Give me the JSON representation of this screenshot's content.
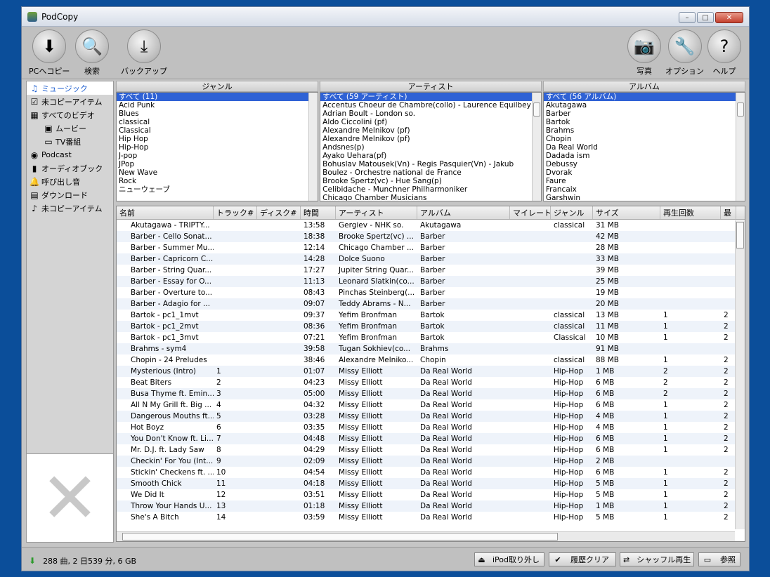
{
  "window": {
    "title": "PodCopy",
    "minimize": "–",
    "maximize": "□",
    "close": "✕"
  },
  "toolbar": {
    "left": [
      {
        "label": "PCへコピー",
        "icon": "down-arrow-icon",
        "glyph": "⬇"
      },
      {
        "label": "検索",
        "icon": "magnifier-icon",
        "glyph": "🔍"
      },
      {
        "label": "バックアップ",
        "icon": "backup-icon",
        "glyph": "⤓"
      }
    ],
    "right": [
      {
        "label": "写真",
        "icon": "camera-icon",
        "glyph": "📷"
      },
      {
        "label": "オプション",
        "icon": "wrench-icon",
        "glyph": "🔧"
      },
      {
        "label": "ヘルプ",
        "icon": "help-icon",
        "glyph": "?"
      }
    ]
  },
  "sidebar": {
    "items": [
      {
        "label": "ミュージック",
        "icon": "music-icon",
        "glyph": "♫",
        "sub": false,
        "selected": true
      },
      {
        "label": "未コピーアイテム",
        "icon": "checkbox-icon",
        "glyph": "☑",
        "sub": false,
        "selected": false
      },
      {
        "label": "すべてのビデオ",
        "icon": "film-icon",
        "glyph": "▦",
        "sub": false,
        "selected": false
      },
      {
        "label": "ムービー",
        "icon": "movie-icon",
        "glyph": "▣",
        "sub": true,
        "selected": false
      },
      {
        "label": "TV番組",
        "icon": "tv-icon",
        "glyph": "▭",
        "sub": true,
        "selected": false
      },
      {
        "label": "Podcast",
        "icon": "podcast-icon",
        "glyph": "◉",
        "sub": false,
        "selected": false
      },
      {
        "label": "オーディオブック",
        "icon": "audiobook-icon",
        "glyph": "▮",
        "sub": false,
        "selected": false
      },
      {
        "label": "呼び出し音",
        "icon": "bell-icon",
        "glyph": "🔔",
        "sub": false,
        "selected": false
      },
      {
        "label": "ダウンロード",
        "icon": "download-icon",
        "glyph": "▤",
        "sub": false,
        "selected": false
      },
      {
        "label": "未コピーアイテム",
        "icon": "note-icon",
        "glyph": "♪",
        "sub": false,
        "selected": false
      }
    ],
    "artwork_glyph": "✕"
  },
  "browser": {
    "genre": {
      "header": "ジャンル",
      "items": [
        "すべて (11)",
        "Acid Punk",
        "Blues",
        "classical",
        "Classical",
        "Hip Hop",
        "Hip-Hop",
        "J-pop",
        "JPop",
        "New Wave",
        "Rock",
        "ニューウェーブ"
      ]
    },
    "artist": {
      "header": "アーティスト",
      "items": [
        "すべて (59 アーティスト)",
        "Accentus Choeur de Chambre(collo) - Laurence Equilbey",
        "Adrian Boult - London so.",
        "Aldo Ciccolini (pf)",
        "Alexandre Melnikov (pf)",
        "Alexandre Melnikov (pf)",
        "Andsnes(p)",
        "Ayako Uehara(pf)",
        "Bohuslav Matousek(Vn) - Regis Pasquier(Vn) - Jakub",
        "Boulez - Orchestre national de France",
        "Brooke Spertz(vc) - Hue Sang(p)",
        "Celibidache - Munchner Philharmoniker",
        "Chicago Chamber Musicians"
      ]
    },
    "album": {
      "header": "アルバム",
      "items": [
        "すべて (56 アルバム)",
        "Akutagawa",
        "Barber",
        "Bartok",
        "Brahms",
        "Chopin",
        "Da Real World",
        "Dadada ism",
        "Debussy",
        "Dvorak",
        "Faure",
        "Francaix",
        "Garshwin"
      ]
    }
  },
  "table": {
    "columns": [
      "名前",
      "トラック#",
      "ディスク#",
      "時間",
      "アーティスト",
      "アルバム",
      "マイレート",
      "ジャンル",
      "サイズ",
      "再生回数",
      "最"
    ],
    "rows": [
      [
        "Akutagawa - TRIPTY...",
        "",
        "",
        "13:58",
        "Gergiev - NHK so.",
        "Akutagawa",
        "",
        "classical",
        "31 MB",
        "",
        ""
      ],
      [
        "Barber - Cello Sonat...",
        "",
        "",
        "18:38",
        "Brooke Spertz(vc) ...",
        "Barber",
        "",
        "",
        "42 MB",
        "",
        ""
      ],
      [
        "Barber - Summer Mu...",
        "",
        "",
        "12:14",
        "Chicago Chamber ...",
        "Barber",
        "",
        "",
        "28 MB",
        "",
        ""
      ],
      [
        "Barber - Capricorn C...",
        "",
        "",
        "14:28",
        "Dolce Suono",
        "Barber",
        "",
        "",
        "33 MB",
        "",
        ""
      ],
      [
        "Barber - String Quar...",
        "",
        "",
        "17:27",
        "Jupiter String Quar...",
        "Barber",
        "",
        "",
        "39 MB",
        "",
        ""
      ],
      [
        "Barber - Essay for O...",
        "",
        "",
        "11:13",
        "Leonard Slatkin(co...",
        "Barber",
        "",
        "",
        "25 MB",
        "",
        ""
      ],
      [
        "Barber - Overture to...",
        "",
        "",
        "08:43",
        "Pinchas Steinberg(...",
        "Barber",
        "",
        "",
        "19 MB",
        "",
        ""
      ],
      [
        "Barber - Adagio for ...",
        "",
        "",
        "09:07",
        "Teddy Abrams - N...",
        "Barber",
        "",
        "",
        "20 MB",
        "",
        ""
      ],
      [
        "Bartok - pc1_1mvt",
        "",
        "",
        "09:37",
        "Yefim Bronfman",
        "Bartok",
        "",
        "classical",
        "13 MB",
        "1",
        "2"
      ],
      [
        "Bartok - pc1_2mvt",
        "",
        "",
        "08:36",
        "Yefim Bronfman",
        "Bartok",
        "",
        "classical",
        "11 MB",
        "1",
        "2"
      ],
      [
        "Bartok - pc1_3mvt",
        "",
        "",
        "07:21",
        "Yefim Bronfman",
        "Bartok",
        "",
        "Classical",
        "10 MB",
        "1",
        "2"
      ],
      [
        "Brahms - sym4",
        "",
        "",
        "39:58",
        "Tugan Sokhiev(co...",
        "Brahms",
        "",
        "",
        "91 MB",
        "",
        ""
      ],
      [
        "Chopin - 24 Preludes",
        "",
        "",
        "38:46",
        "Alexandre Melniko...",
        "Chopin",
        "",
        "classical",
        "88 MB",
        "1",
        "2"
      ],
      [
        "Mysterious (Intro)",
        "1",
        "",
        "01:07",
        "Missy Elliott",
        "Da Real World",
        "",
        "Hip-Hop",
        "1 MB",
        "2",
        "2"
      ],
      [
        "Beat Biters",
        "2",
        "",
        "04:23",
        "Missy Elliott",
        "Da Real World",
        "",
        "Hip-Hop",
        "6 MB",
        "2",
        "2"
      ],
      [
        "Busa Thyme ft. Emin...",
        "3",
        "",
        "05:00",
        "Missy Elliott",
        "Da Real World",
        "",
        "Hip-Hop",
        "6 MB",
        "2",
        "2"
      ],
      [
        "All N My Grill ft. Big ...",
        "4",
        "",
        "04:32",
        "Missy Elliott",
        "Da Real World",
        "",
        "Hip-Hop",
        "6 MB",
        "1",
        "2"
      ],
      [
        "Dangerous Mouths ft....",
        "5",
        "",
        "03:28",
        "Missy Elliott",
        "Da Real World",
        "",
        "Hip-Hop",
        "4 MB",
        "1",
        "2"
      ],
      [
        "Hot Boyz",
        "6",
        "",
        "03:35",
        "Missy Elliott",
        "Da Real World",
        "",
        "Hip-Hop",
        "4 MB",
        "1",
        "2"
      ],
      [
        "You Don't Know ft. Li...",
        "7",
        "",
        "04:48",
        "Missy Elliott",
        "Da Real World",
        "",
        "Hip-Hop",
        "6 MB",
        "1",
        "2"
      ],
      [
        "Mr. D.J. ft. Lady Saw",
        "8",
        "",
        "04:29",
        "Missy Elliott",
        "Da Real World",
        "",
        "Hip-Hop",
        "6 MB",
        "1",
        "2"
      ],
      [
        "Checkin' For You (Int...",
        "9",
        "",
        "02:09",
        "Missy Elliott",
        "Da Real World",
        "",
        "Hip-Hop",
        "2 MB",
        "",
        ""
      ],
      [
        "Stickin' Checkens ft. ...",
        "10",
        "",
        "04:54",
        "Missy Elliott",
        "Da Real World",
        "",
        "Hip-Hop",
        "6 MB",
        "1",
        "2"
      ],
      [
        "Smooth Chick",
        "11",
        "",
        "04:18",
        "Missy Elliott",
        "Da Real World",
        "",
        "Hip-Hop",
        "5 MB",
        "1",
        "2"
      ],
      [
        "We Did It",
        "12",
        "",
        "03:51",
        "Missy Elliott",
        "Da Real World",
        "",
        "Hip-Hop",
        "5 MB",
        "1",
        "2"
      ],
      [
        "Throw Your Hands U...",
        "13",
        "",
        "01:18",
        "Missy Elliott",
        "Da Real World",
        "",
        "Hip-Hop",
        "1 MB",
        "1",
        "2"
      ],
      [
        "She's A Bitch",
        "14",
        "",
        "03:59",
        "Missy Elliott",
        "Da Real World",
        "",
        "Hip-Hop",
        "5 MB",
        "1",
        "2"
      ]
    ]
  },
  "status": {
    "text": "288 曲, 2 日539 分, 6 GB",
    "buttons": [
      {
        "label": "iPod取り外し",
        "icon": "eject-icon",
        "glyph": "⏏"
      },
      {
        "label": "履歴クリア",
        "icon": "check-icon",
        "glyph": "✔"
      },
      {
        "label": "シャッフル再生",
        "icon": "shuffle-icon",
        "glyph": "⇄"
      },
      {
        "label": "参照",
        "icon": "browse-icon",
        "glyph": "▭"
      }
    ]
  }
}
